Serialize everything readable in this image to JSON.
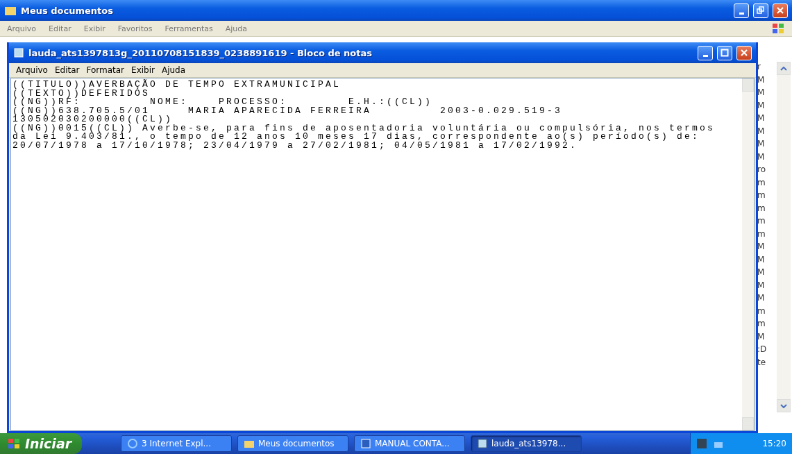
{
  "explorer": {
    "title": "Meus documentos",
    "menu": [
      "Arquivo",
      "Editar",
      "Exibir",
      "Favoritos",
      "Ferramentas",
      "Ajuda"
    ],
    "list_fragments": [
      "r",
      "M",
      "M",
      "M",
      "M",
      "M",
      "M",
      "M",
      "ro",
      "m",
      "m",
      "m",
      "m",
      "m",
      "M",
      "M",
      "M",
      "M",
      "M",
      "m",
      "m",
      "M",
      ":D",
      "te"
    ]
  },
  "notepad": {
    "title": "lauda_ats1397813g_20110708151839_0238891619 - Bloco de notas",
    "menu": [
      "Arquivo",
      "Editar",
      "Formatar",
      "Exibir",
      "Ajuda"
    ],
    "lines": [
      "((TITULO))AVERBAÇÃO DE TEMPO EXTRAMUNICIPAL",
      "((TEXTO))DEFERIDOS",
      "((NG))RF:         NOME:    PROCESSO:        E.H.:((CL))",
      "((NG))638.705.5/01     MARIA APARECIDA FERREIRA         2003-0.029.519-3",
      "130502030200000((CL))",
      "((NG))0015((CL)) Averbe-se, para fins de aposentadoria voluntária ou compulsória, nos termos",
      "da Lei 9.403/81., o tempo de 12 anos 10 meses 17 dias, correspondente ao(s) período(s) de:",
      "20/07/1978 a 17/10/1978; 23/04/1979 a 27/02/1981; 04/05/1981 a 17/02/1992."
    ]
  },
  "taskbar": {
    "start": "Iniciar",
    "items": [
      {
        "label": "3 Internet Expl...",
        "kind": "browser",
        "selected": false
      },
      {
        "label": "Meus documentos",
        "kind": "folder",
        "selected": false
      },
      {
        "label": "MANUAL CONTA...",
        "kind": "document",
        "selected": false
      },
      {
        "label": "lauda_ats13978...",
        "kind": "notepad",
        "selected": true
      }
    ],
    "clock": "15:20"
  }
}
